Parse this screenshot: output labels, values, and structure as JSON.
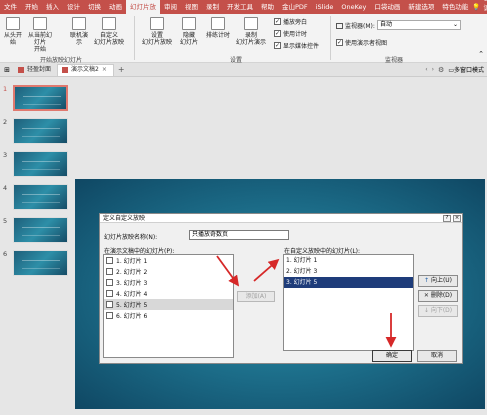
{
  "tabs": [
    "文件",
    "开始",
    "插入",
    "设计",
    "切换",
    "动画",
    "幻灯片放",
    "审阅",
    "视图",
    "录制",
    "开发工具",
    "帮助",
    "金山PDF",
    "iSlide",
    "OneKey",
    "口袋动画",
    "新建选项",
    "特色功能"
  ],
  "active_tab_index": 6,
  "tab_search": "告诉我",
  "ribbon": {
    "from_start": "从头开始",
    "from_current_1": "从当前幻灯片",
    "from_current_2": "开始",
    "online_present": "联机演示",
    "custom_show_1": "自定义",
    "custom_show_2": "幻灯片放映",
    "group_start": "开始放映幻灯片",
    "setup_1": "设置",
    "setup_2": "幻灯片放映",
    "hide_1": "隐藏",
    "hide_2": "幻灯片",
    "rehearse": "排练计时",
    "record_1": "录制",
    "record_2": "幻灯片演示",
    "chk_narration": "播放旁白",
    "chk_timing": "使用计时",
    "chk_media": "显示媒体控件",
    "group_setup": "设置",
    "monitor_label": "监视器(M):",
    "monitor_value": "自动",
    "presenter_view": "使用演示者视图",
    "group_monitor": "监视器"
  },
  "doc_tabs": [
    "轻盈封面",
    "演示文稿2"
  ],
  "doc_tab_right": "多窗口模式",
  "slide_numbers": [
    "1",
    "2",
    "3",
    "4",
    "5",
    "6"
  ],
  "dialog": {
    "title": "定义自定义放映",
    "help": "?",
    "close": "×",
    "name_label": "幻灯片放映名称(N):",
    "name_value": "只播放奇数页",
    "left_header": "在演示文稿中的幻灯片(P):",
    "right_header": "在自定义放映中的幻灯片(L):",
    "left_items": [
      "1. 幻灯片 1",
      "2. 幻灯片 2",
      "3. 幻灯片 3",
      "4. 幻灯片 4",
      "5. 幻灯片 5",
      "6. 幻灯片 6"
    ],
    "right_items": [
      "1. 幻灯片 1",
      "2. 幻灯片 3",
      "3. 幻灯片 5"
    ],
    "add_button": "添加(A)",
    "up_button": "向上(U)",
    "delete_button": "删除(D)",
    "down_button": "向下(D)",
    "ok_button": "确定",
    "cancel_button": "取消"
  },
  "colors": {
    "accent": "#c4504a",
    "arrow": "#d62828",
    "selection": "#1e3c7a"
  }
}
